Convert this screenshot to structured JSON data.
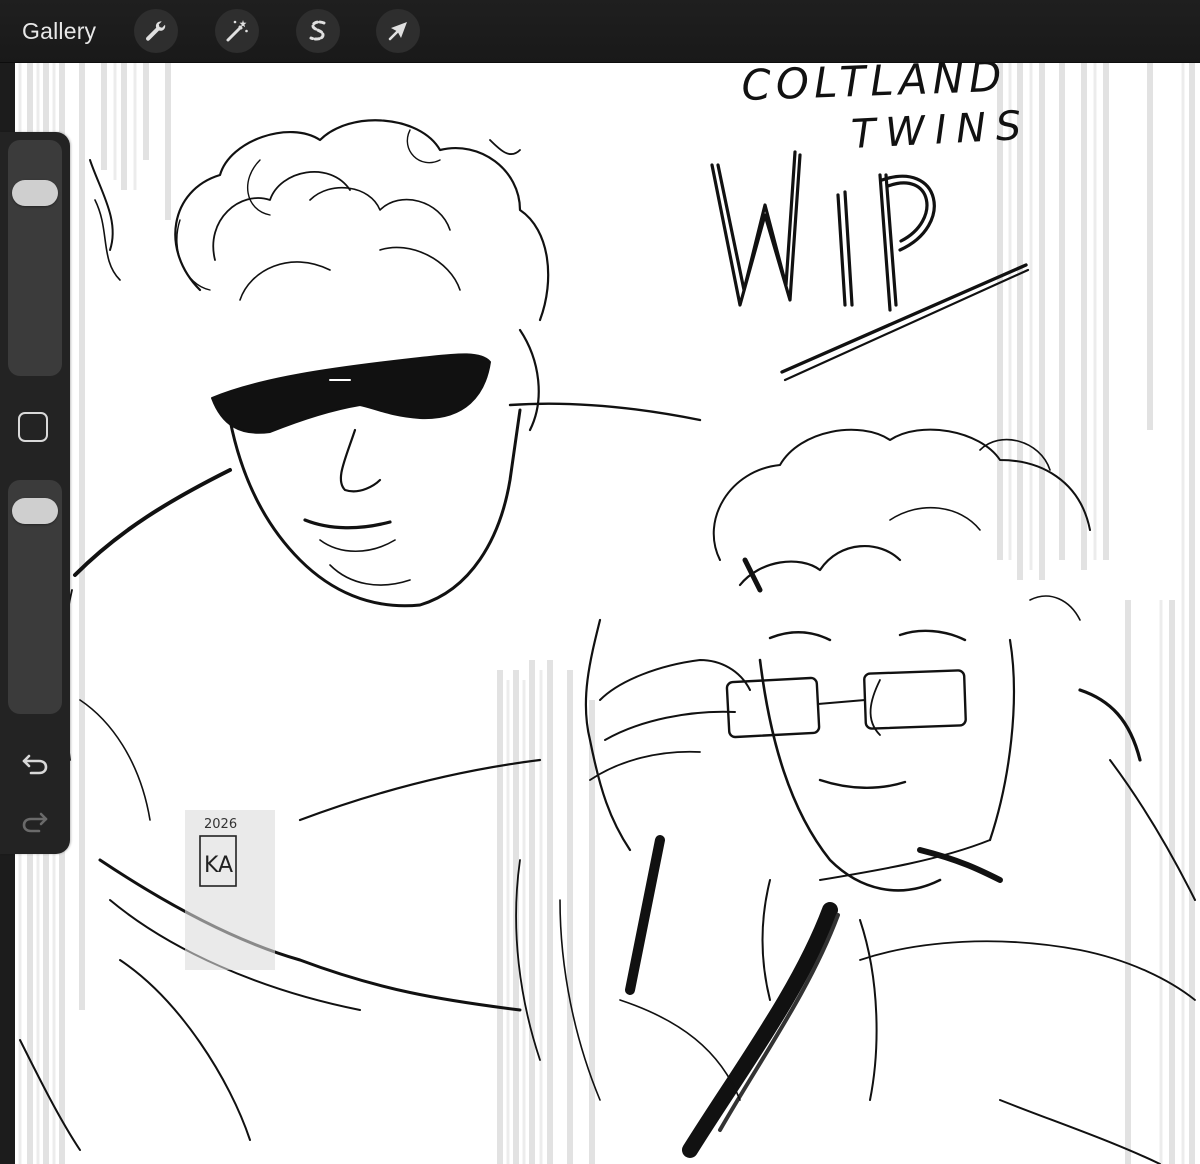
{
  "toolbar": {
    "gallery_label": "Gallery",
    "tools": [
      {
        "name": "actions",
        "icon": "wrench-icon"
      },
      {
        "name": "adjustments",
        "icon": "magic-wand-icon"
      },
      {
        "name": "selection",
        "icon": "selection-s-icon"
      },
      {
        "name": "transform",
        "icon": "arrow-cursor-icon"
      }
    ]
  },
  "sidebar": {
    "brush_size": {
      "level": 0.82
    },
    "opacity": {
      "level": 0.93
    },
    "modify_icon": "square-icon",
    "undo_icon": "undo-arrow-icon",
    "redo_icon": "redo-arrow-icon"
  },
  "canvas": {
    "background_color": "#ffffff",
    "ink_color": "#111111",
    "artwork": "sketch-wip",
    "lettering": {
      "title_line_1": "COLTLAND",
      "title_line_2": "TWINS",
      "title_big": "WIP",
      "signature_year": "2026",
      "signature_initials": "KA"
    }
  },
  "colors": {
    "toolbar_bg": "#1c1c1c",
    "tool_button_bg": "#2e2e2e",
    "icon_color": "#e0e0e0",
    "sidebar_bg": "#232323",
    "slider_track": "#3b3b3b",
    "slider_thumb": "#cfcfcf"
  }
}
